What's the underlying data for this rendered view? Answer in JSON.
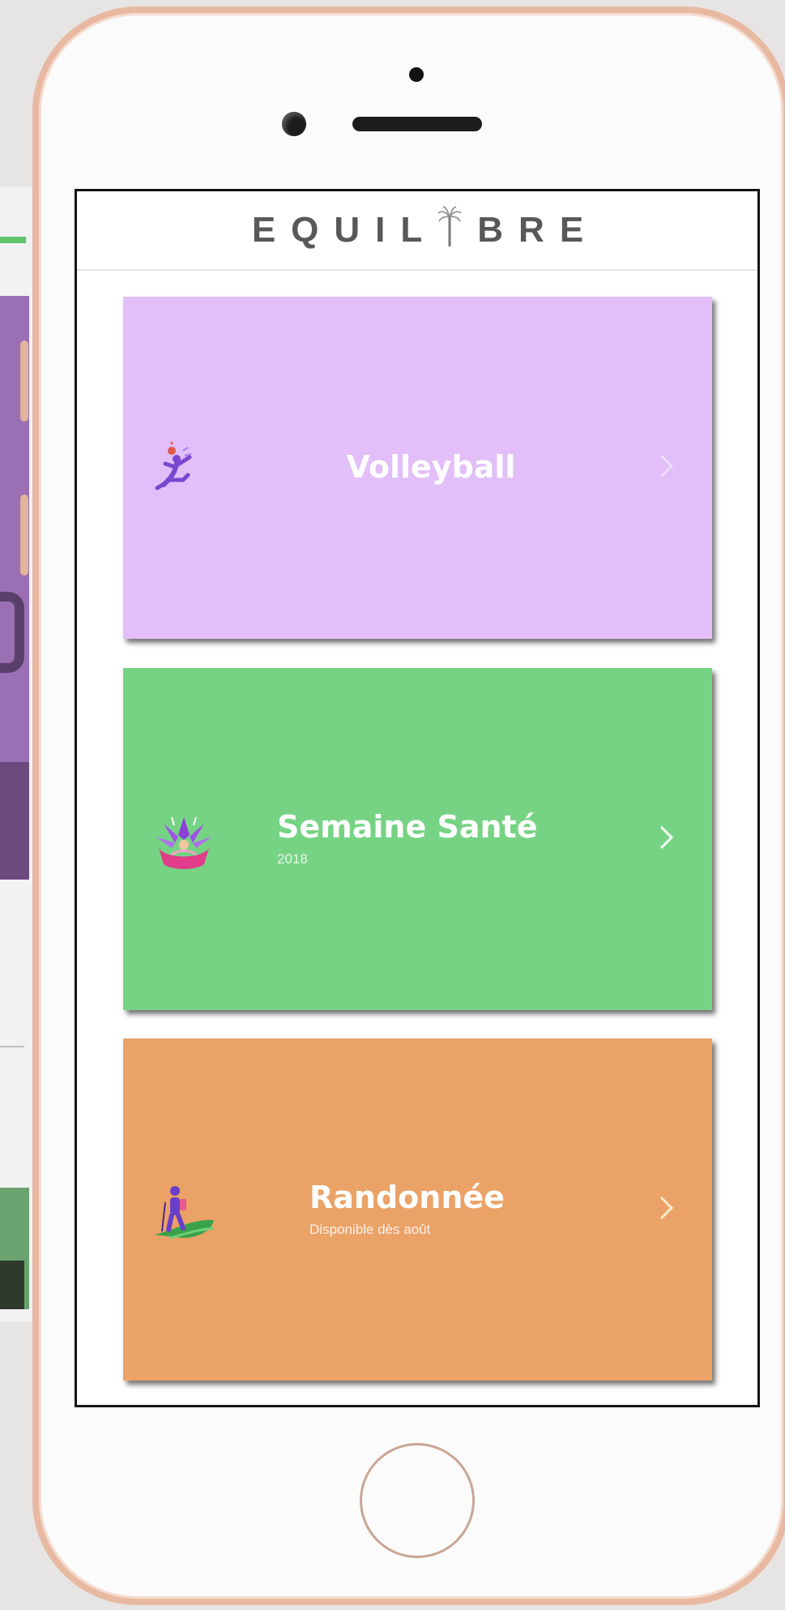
{
  "app": {
    "logo_text_before": "EQUIL",
    "logo_text_after": "BRE"
  },
  "cards": [
    {
      "title": "Volleyball",
      "subtitle": "",
      "icon": "volleyball-player-icon",
      "color": "#e2bff8"
    },
    {
      "title": "Semaine Santé",
      "subtitle": "2018",
      "icon": "lotus-meditation-icon",
      "color": "#76d384"
    },
    {
      "title": "Randonnée",
      "subtitle": "Disponible dès août",
      "icon": "hiker-icon",
      "color": "#eba267"
    }
  ],
  "colors": {
    "phone_frame": "#e8b9a2",
    "screen_border": "#141414",
    "logo": "#585858"
  }
}
